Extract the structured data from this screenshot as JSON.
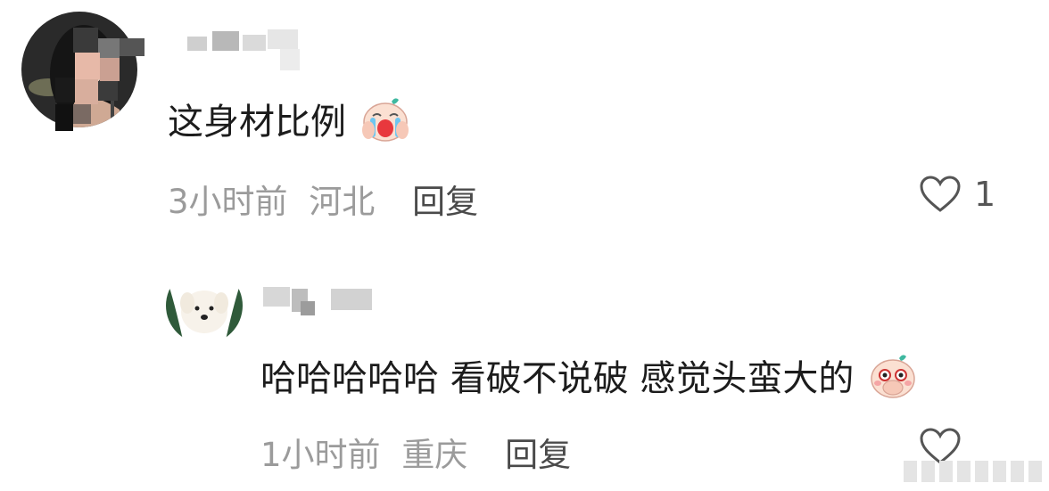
{
  "comments": [
    {
      "username": "",
      "text": "这身材比例",
      "emoji": "crying-laughing-peach-emoji",
      "time": "3小时前",
      "location": "河北",
      "reply_label": "回复",
      "likes": "1"
    },
    {
      "username": "",
      "text": "哈哈哈哈哈 看破不说破 感觉头蛮大的",
      "emoji": "covering-mouth-peach-emoji",
      "time": "1小时前",
      "location": "重庆",
      "reply_label": "回复",
      "likes": ""
    }
  ],
  "colors": {
    "text": "#1c1c1c",
    "meta": "#9b9b9b",
    "reply": "#4a4a4a",
    "icon": "#555555"
  },
  "icons": [
    "heart-outline-icon"
  ]
}
